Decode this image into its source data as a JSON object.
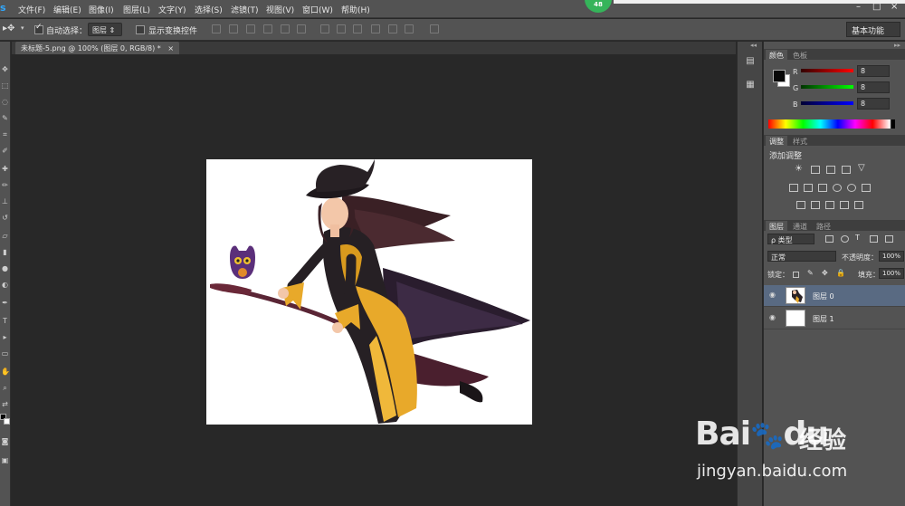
{
  "app": {
    "logo": "s"
  },
  "menu": [
    "文件(F)",
    "编辑(E)",
    "图像(I)",
    "图层(L)",
    "文字(Y)",
    "选择(S)",
    "滤镜(T)",
    "视图(V)",
    "窗口(W)",
    "帮助(H)"
  ],
  "badge": "48",
  "window_buttons": [
    "–",
    "□",
    "×"
  ],
  "options": {
    "auto_select_label": "自动选择：",
    "auto_select_value": "图层",
    "transform_label": "显示变换控件",
    "workspace": "基本功能"
  },
  "document": {
    "tab_label": "未标题-5.png @ 100% (图层 0, RGB/8) *",
    "close": "×"
  },
  "color_panel": {
    "tabs": [
      "颜色",
      "色板"
    ],
    "r_label": "R",
    "g_label": "G",
    "b_label": "B",
    "r_value": "8",
    "g_value": "8",
    "b_value": "8",
    "foreground": "#080808",
    "background": "#ffffff"
  },
  "adjust_panel": {
    "tabs": [
      "调整",
      "样式"
    ],
    "title": "添加调整"
  },
  "layers_panel": {
    "tabs": [
      "图层",
      "通道",
      "路径"
    ],
    "filter_value": "ρ 类型",
    "blend_mode": "正常",
    "opacity_label": "不透明度：",
    "opacity_value": "100%",
    "lock_label": "锁定：",
    "fill_label": "填充：",
    "fill_value": "100%",
    "layers": [
      {
        "name": "图层 0",
        "selected": true
      },
      {
        "name": "图层 1",
        "selected": false
      }
    ]
  },
  "watermark": {
    "brand": "Bai",
    "brand2": "du",
    "cn": "经验",
    "url": "jingyan.baidu.com"
  },
  "colors": {
    "accent": "#31a8ff",
    "badge": "#35b45a",
    "selected_layer": "#596a82"
  }
}
